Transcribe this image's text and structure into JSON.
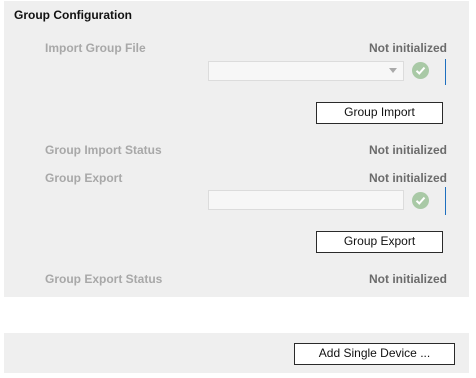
{
  "section": {
    "title": "Group Configuration"
  },
  "import": {
    "label": "Import Group File",
    "status": "Not initialized",
    "file_value": "",
    "button_label": "Group Import"
  },
  "import_status": {
    "label": "Group Import Status",
    "value": "Not initialized"
  },
  "export": {
    "label": "Group Export",
    "status": "Not initialized",
    "file_value": "",
    "button_label": "Group Export"
  },
  "export_status": {
    "label": "Group Export Status",
    "value": "Not initialized"
  },
  "footer": {
    "add_single_device_label": "Add Single Device ..."
  },
  "icons": {
    "check": "check-circle-icon",
    "dropdown": "chevron-down-icon"
  },
  "colors": {
    "check_green": "#a9c9a6",
    "accent_line": "#1d6fbf"
  }
}
